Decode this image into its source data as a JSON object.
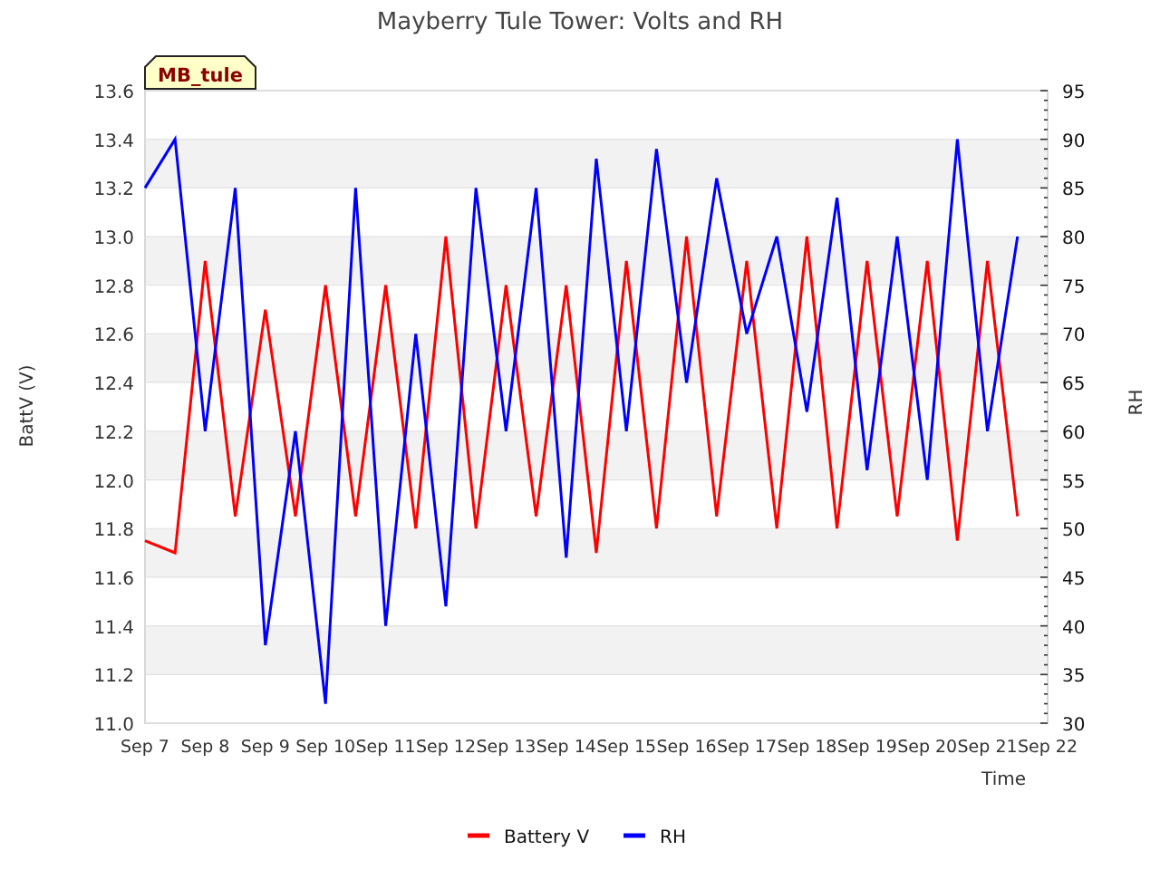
{
  "title": "Mayberry Tule Tower: Volts and RH",
  "site_label": "MB_tule",
  "chart_data": {
    "type": "line",
    "xlabel": "Time",
    "ylabel": "BattV (V)",
    "y2label": "RH",
    "categories": [
      "Sep 7",
      null,
      "Sep 8",
      null,
      "Sep 9",
      null,
      "Sep 10",
      null,
      "Sep 11",
      null,
      "Sep 12",
      null,
      "Sep 13",
      null,
      "Sep 14",
      null,
      "Sep 15",
      null,
      "Sep 16",
      null,
      "Sep 17",
      null,
      "Sep 18",
      null,
      "Sep 19",
      null,
      "Sep 20",
      null,
      "Sep 21",
      null,
      "Sep 22"
    ],
    "series": [
      {
        "name": "Battery V",
        "color": "#ff0000",
        "values": [
          11.75,
          11.7,
          12.9,
          11.85,
          12.7,
          11.85,
          12.8,
          11.85,
          12.8,
          11.8,
          13.0,
          11.8,
          12.8,
          11.85,
          12.8,
          11.7,
          12.9,
          11.8,
          13.0,
          11.85,
          12.9,
          11.8,
          13.0,
          11.8,
          12.9,
          11.85,
          12.9,
          11.75,
          12.9,
          11.85,
          null
        ]
      },
      {
        "name": "RH",
        "color": "#0000ff",
        "axis": "y2",
        "values": [
          85,
          90,
          60,
          85,
          38,
          60,
          32,
          85,
          40,
          70,
          42,
          85,
          60,
          85,
          47,
          88,
          60,
          89,
          65,
          86,
          70,
          80,
          62,
          84,
          56,
          80,
          55,
          90,
          60,
          80,
          null
        ]
      }
    ],
    "ylim": [
      11.0,
      13.6
    ],
    "y2lim": [
      30,
      95
    ],
    "grid": true,
    "legend": "bottom",
    "yticks": [
      {
        "value": 11.0,
        "label": "11.0"
      },
      {
        "value": 11.2,
        "label": "11.2"
      },
      {
        "value": 11.4,
        "label": "11.4"
      },
      {
        "value": 11.6,
        "label": "11.6"
      },
      {
        "value": 11.8,
        "label": "11.8"
      },
      {
        "value": 12.0,
        "label": "12.0"
      },
      {
        "value": 12.2,
        "label": "12.2"
      },
      {
        "value": 12.4,
        "label": "12.4"
      },
      {
        "value": 12.6,
        "label": "12.6"
      },
      {
        "value": 12.8,
        "label": "12.8"
      },
      {
        "value": 13.0,
        "label": "13.0"
      },
      {
        "value": 13.2,
        "label": "13.2"
      },
      {
        "value": 13.4,
        "label": "13.4"
      },
      {
        "value": 13.6,
        "label": "13.6"
      }
    ],
    "y2ticks": [
      30,
      35,
      40,
      45,
      50,
      55,
      60,
      65,
      70,
      75,
      80,
      85,
      90,
      95
    ]
  }
}
